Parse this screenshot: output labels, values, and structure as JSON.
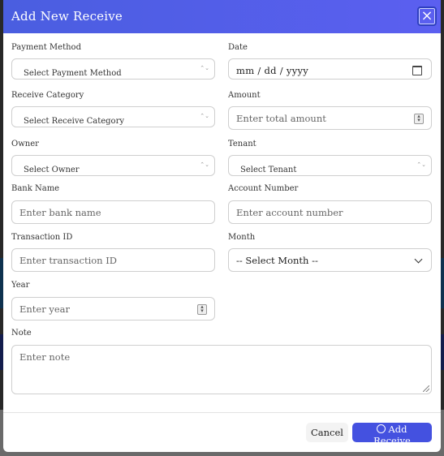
{
  "modal": {
    "title": "Add New Receive",
    "close_icon": "close-icon"
  },
  "form": {
    "payment_method": {
      "label": "Payment Method",
      "placeholder": "Select Payment Method"
    },
    "date": {
      "label": "Date",
      "placeholder": "mm / dd / yyyy"
    },
    "receive_category": {
      "label": "Receive Category",
      "placeholder": "Select Receive Category"
    },
    "amount": {
      "label": "Amount",
      "placeholder": "Enter total amount"
    },
    "owner": {
      "label": "Owner",
      "placeholder": "Select Owner"
    },
    "tenant": {
      "label": "Tenant",
      "placeholder": "Select Tenant"
    },
    "bank_name": {
      "label": "Bank Name",
      "placeholder": "Enter bank name"
    },
    "account_number": {
      "label": "Account Number",
      "placeholder": "Enter account number"
    },
    "transaction_id": {
      "label": "Transaction ID",
      "placeholder": "Enter transaction ID"
    },
    "month": {
      "label": "Month",
      "selected": "-- Select Month --"
    },
    "year": {
      "label": "Year",
      "placeholder": "Enter year"
    },
    "note": {
      "label": "Note",
      "placeholder": "Enter note"
    }
  },
  "footer": {
    "cancel_label": "Cancel",
    "add_label": "Add Receive"
  },
  "colors": {
    "header_bg": "#4a5ee0",
    "primary_button": "#4451e0"
  }
}
